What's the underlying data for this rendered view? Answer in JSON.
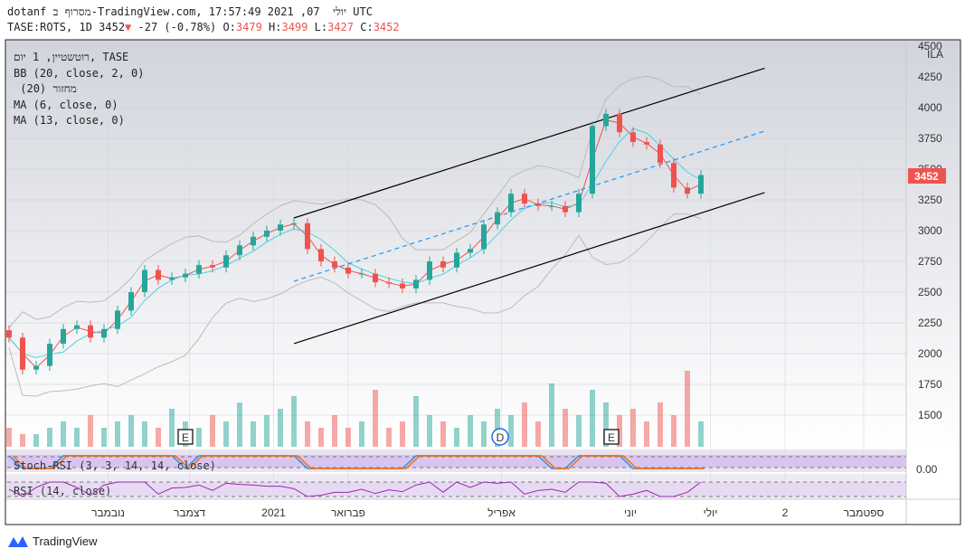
{
  "header": {
    "line1": "dotanf מסרוף ב-TradingView.com, יולי  07, 2021 17:57:49 UTC",
    "symbol": "TASE:ROTS, 1D 3452",
    "change": "-27 (-0.78%)",
    "o_label": "O:",
    "o": "3479",
    "h_label": "H:",
    "h": "3499",
    "l_label": "L:",
    "l": "3427",
    "c_label": "C:",
    "c": "3452"
  },
  "legend": [
    "רוטשטיין, 1 יום, TASE",
    "BB (20, close, 2, 0)",
    " מחזור (20)",
    "MA (6, close, 0)",
    "MA (13, close, 0)"
  ],
  "indicators": {
    "stoch": "Stoch-RSI (3, 3, 14, 14, close)",
    "stoch_value": "0.00",
    "rsi": "RSI (14, close)"
  },
  "brand": "TradingView",
  "colors": {
    "up": "#26a69a",
    "down": "#ef5350",
    "ma6": "#ef5350",
    "ma13": "#4dd0e1",
    "channel": "#000000",
    "mid": "#2196f3",
    "last": "#ef5350"
  },
  "chart_data": {
    "type": "candlestick",
    "currency": "ILA",
    "last_price": "3452",
    "ylim": [
      1250,
      4500
    ],
    "yticks": [
      "4500",
      "4250",
      "4000",
      "3750",
      "3500",
      "3250",
      "3000",
      "2750",
      "2500",
      "2250",
      "2000",
      "1750",
      "1500"
    ],
    "xticks": [
      {
        "label": "נובמבר",
        "i": 7.3
      },
      {
        "label": "דצמבר",
        "i": 13.3
      },
      {
        "label": "2021",
        "i": 19.5
      },
      {
        "label": "פברואר",
        "i": 25
      },
      {
        "label": "אפריל",
        "i": 36.3
      },
      {
        "label": "יוני",
        "i": 45.8
      },
      {
        "label": "יולי",
        "i": 51.7
      },
      {
        "label": "2",
        "i": 57.2
      },
      {
        "label": "ספטמבר",
        "i": 63
      }
    ],
    "close": [
      2130,
      1870,
      1900,
      2080,
      2200,
      2230,
      2130,
      2200,
      2350,
      2500,
      2680,
      2600,
      2620,
      2650,
      2720,
      2700,
      2800,
      2880,
      2950,
      3000,
      3050,
      3060,
      2850,
      2750,
      2700,
      2650,
      2650,
      2580,
      2570,
      2530,
      2600,
      2750,
      2700,
      2820,
      2850,
      3050,
      3150,
      3300,
      3220,
      3200,
      3200,
      3150,
      3300,
      3850,
      3950,
      3800,
      3720,
      3700,
      3550,
      3350,
      3300,
      3452
    ],
    "volume": [
      3,
      2,
      2,
      3,
      4,
      3,
      5,
      3,
      4,
      5,
      4,
      3,
      6,
      4,
      3,
      5,
      4,
      7,
      4,
      5,
      6,
      8,
      4,
      3,
      5,
      3,
      4,
      9,
      3,
      4,
      8,
      5,
      4,
      3,
      5,
      4,
      6,
      5,
      7,
      4,
      10,
      6,
      5,
      9,
      7,
      5,
      6,
      4,
      7,
      5,
      12,
      4
    ],
    "events": [
      {
        "label": "E",
        "i": 13
      },
      {
        "label": "D",
        "i": 36.2
      },
      {
        "label": "E",
        "i": 44.4
      }
    ],
    "channel": {
      "upper": [
        [
          21,
          3103
        ],
        [
          55.7,
          4320
        ]
      ],
      "lower": [
        [
          21,
          2081
        ],
        [
          55.7,
          3309
        ]
      ],
      "mid": [
        [
          21,
          2588
        ],
        [
          55.7,
          3809
        ]
      ]
    }
  }
}
